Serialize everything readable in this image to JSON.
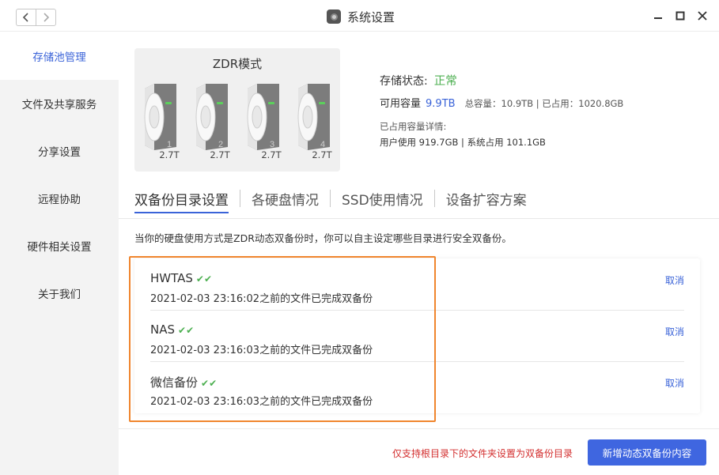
{
  "window": {
    "title": "系统设置"
  },
  "sidebar": {
    "items": [
      {
        "label": "存储池管理",
        "active": true
      },
      {
        "label": "文件及共享服务",
        "active": false
      },
      {
        "label": "分享设置",
        "active": false
      },
      {
        "label": "远程协助",
        "active": false
      },
      {
        "label": "硬件相关设置",
        "active": false
      },
      {
        "label": "关于我们",
        "active": false
      }
    ]
  },
  "storage": {
    "mode_title": "ZDR模式",
    "disks": [
      {
        "number": "1",
        "size": "2.7T"
      },
      {
        "number": "2",
        "size": "2.7T"
      },
      {
        "number": "3",
        "size": "2.7T"
      },
      {
        "number": "4",
        "size": "2.7T"
      }
    ],
    "status_label": "存储状态:",
    "status_value": "正常",
    "available_label": "可用容量",
    "available_value": "9.9TB",
    "total_text": "总容量：10.9TB | 已占用：1020.8GB",
    "detail_title": "已占用容量详情:",
    "detail_text": "用户使用 919.7GB | 系统占用 101.1GB"
  },
  "tabs": [
    {
      "label": "双备份目录设置",
      "active": true
    },
    {
      "label": "各硬盘情况",
      "active": false
    },
    {
      "label": "SSD使用情况",
      "active": false
    },
    {
      "label": "设备扩容方案",
      "active": false
    }
  ],
  "description": "当你的硬盘使用方式是ZDR动态双备份时，你可以自主设定哪些目录进行安全双备份。",
  "backups": [
    {
      "name": "HWTAS",
      "checks": "✔✔",
      "time": "2021-02-03 23:16:02之前的文件已完成双备份",
      "action": "取消"
    },
    {
      "name": "NAS",
      "checks": "✔✔",
      "time": "2021-02-03 23:16:03之前的文件已完成双备份",
      "action": "取消"
    },
    {
      "name": "微信备份",
      "checks": "✔✔",
      "time": "2021-02-03 23:16:03之前的文件已完成双备份",
      "action": "取消"
    }
  ],
  "footer": {
    "note": "仅支持根目录下的文件夹设置为双备份目录",
    "add_button": "新增动态双备份内容"
  },
  "colors": {
    "accent": "#3f66e0",
    "ok": "#4caf50",
    "warning_text": "#d32f2f",
    "highlight": "#f0852d"
  }
}
